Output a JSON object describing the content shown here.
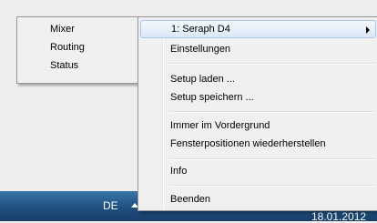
{
  "submenu": {
    "items": [
      {
        "label": "Mixer"
      },
      {
        "label": "Routing"
      },
      {
        "label": "Status"
      }
    ]
  },
  "context_menu": {
    "items": [
      {
        "label": "1: Seraph D4"
      },
      {
        "label": "Einstellungen"
      },
      {
        "label": "Setup laden ..."
      },
      {
        "label": "Setup speichern ..."
      },
      {
        "label": "Immer im Vordergrund"
      },
      {
        "label": "Fensterpositionen wiederherstellen"
      },
      {
        "label": "Info"
      },
      {
        "label": "Beenden"
      }
    ]
  },
  "taskbar": {
    "language": "DE",
    "date": "18.01.2012",
    "background": "#1f4f80"
  },
  "colors": {
    "highlight": "#dbe8f7",
    "menu_bg": "#f0f0f0"
  }
}
